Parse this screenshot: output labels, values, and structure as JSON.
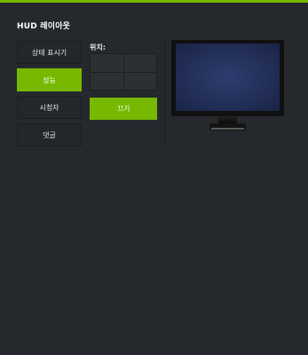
{
  "panel": {
    "title": "HUD 레이아웃",
    "accent_color": "#76b900"
  },
  "menu": {
    "items": [
      {
        "label": "상태 표시기",
        "active": false
      },
      {
        "label": "성능",
        "active": true
      },
      {
        "label": "시청자",
        "active": false
      },
      {
        "label": "댓글",
        "active": false
      }
    ]
  },
  "position": {
    "label": "위치:",
    "off_button": "끄기"
  },
  "preview": {
    "icon": "monitor-icon"
  }
}
